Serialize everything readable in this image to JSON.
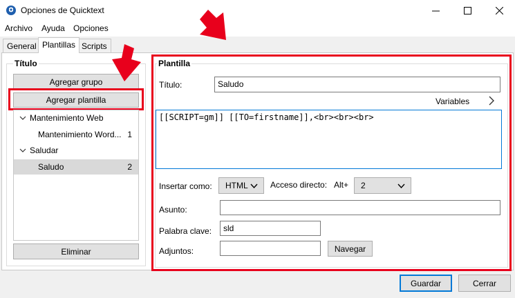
{
  "window": {
    "title": "Opciones de Quicktext"
  },
  "menu": {
    "items": [
      "Archivo",
      "Ayuda",
      "Opciones"
    ]
  },
  "tabs": [
    {
      "label": "General"
    },
    {
      "label": "Plantillas"
    },
    {
      "label": "Scripts"
    }
  ],
  "left": {
    "group_title": "Título",
    "add_group_label": "Agregar grupo",
    "add_template_label": "Agregar plantilla",
    "delete_label": "Eliminar",
    "tree": [
      {
        "label": "Mantenimiento Web"
      },
      {
        "label": "Mantenimiento Word...",
        "count": "1"
      },
      {
        "label": "Saludar"
      },
      {
        "label": "Saludo",
        "count": "2"
      }
    ]
  },
  "right": {
    "group_title": "Plantilla",
    "title_label": "Título:",
    "title_value": "Saludo",
    "variables_label": "Variables",
    "body_text": "[[SCRIPT=gm]] [[TO=firstname]],<br><br><br>",
    "insert_as_label": "Insertar como:",
    "insert_as_value": "HTML",
    "shortcut_label": "Acceso directo:",
    "shortcut_mod": "Alt+",
    "shortcut_value": "2",
    "subject_label": "Asunto:",
    "subject_value": "",
    "keyword_label": "Palabra clave:",
    "keyword_value": "sld",
    "attachments_label": "Adjuntos:",
    "attachments_value": "",
    "browse_label": "Navegar"
  },
  "footer": {
    "save_label": "Guardar",
    "cancel_label": "Cerrar"
  },
  "colors": {
    "highlight_red": "#e8001c",
    "selection_gray": "#d9d9d9",
    "accent_blue": "#0078d7"
  }
}
